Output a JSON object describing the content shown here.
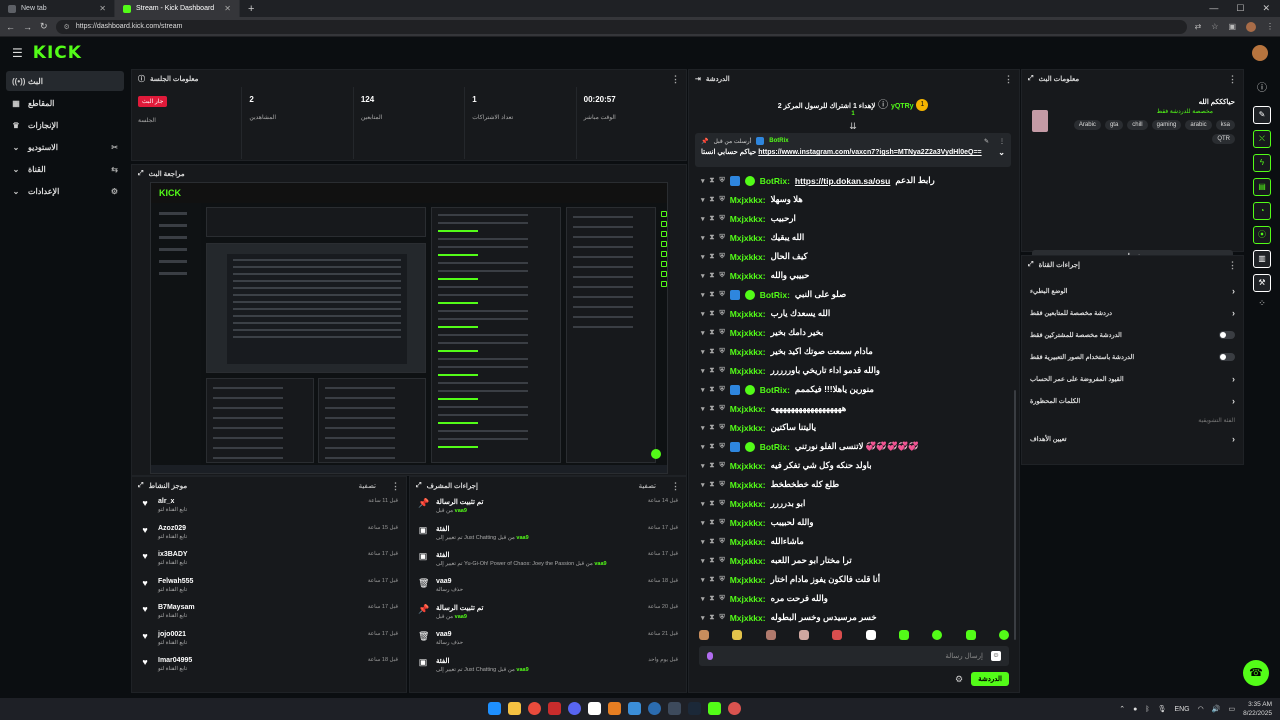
{
  "browser": {
    "tabs": [
      {
        "label": "New tab"
      },
      {
        "label": "Stream - Kick Dashboard"
      }
    ],
    "url": "https://dashboard.kick.com/stream"
  },
  "brand": {
    "logo": "KICK",
    "accent": "#53fc18"
  },
  "sidebar": {
    "items": [
      {
        "label": "البث",
        "icon": "broadcast-icon"
      },
      {
        "label": "المقاطع",
        "icon": "clips-icon"
      },
      {
        "label": "الإنجازات",
        "icon": "trophy-icon"
      },
      {
        "label": "الاستوديو",
        "icon": "studio-icon"
      },
      {
        "label": "القناة",
        "icon": "channel-icon"
      },
      {
        "label": "الإعدادات",
        "icon": "settings-icon"
      }
    ]
  },
  "session": {
    "title": "معلومات الجلسة",
    "stats": [
      {
        "value": "جار البث",
        "label": "الجلسة"
      },
      {
        "value": "2",
        "label": "المشاهدين"
      },
      {
        "value": "124",
        "label": "المتابعين"
      },
      {
        "value": "1",
        "label": "تعداد الاشتراكات"
      },
      {
        "value": "00:20:57",
        "label": "الوقت مباشر"
      }
    ]
  },
  "preview": {
    "title": "مراجعة البث"
  },
  "activity": {
    "title": "موجز النشاط",
    "filter": "تصفية",
    "rows": [
      {
        "name": "alr_x",
        "sub": "تابع القناة لتو",
        "time": "قبل 11 ساعة"
      },
      {
        "name": "Azoz029",
        "sub": "تابع القناة لتو",
        "time": "قبل 15 ساعة"
      },
      {
        "name": "ix3BADY",
        "sub": "تابع القناة لتو",
        "time": "قبل 17 ساعة"
      },
      {
        "name": "Felwah555",
        "sub": "تابع القناة لتو",
        "time": "قبل 17 ساعة"
      },
      {
        "name": "B7Maysam",
        "sub": "تابع القناة لتو",
        "time": "قبل 17 ساعة"
      },
      {
        "name": "jojo0021",
        "sub": "تابع القناة لتو",
        "time": "قبل 17 ساعة"
      },
      {
        "name": "Imar04995",
        "sub": "تابع القناة لتو",
        "time": "قبل 18 ساعة"
      }
    ]
  },
  "modactions": {
    "title": "إجراءات المشرف",
    "filter": "تصفية",
    "rows": [
      {
        "name": "تم تثبيت الرسالة",
        "sub_pre": "من قبل",
        "sub_hl": "vaa9",
        "time": "قبل 14 ساعة",
        "icon": "pin-icon"
      },
      {
        "name": "الفئة",
        "sub_pre": "تم تغيير إلى Just Chatting من قبل",
        "sub_hl": "vaa9",
        "time": "قبل 17 ساعة",
        "icon": "category-icon"
      },
      {
        "name": "الفئة",
        "sub_pre": "تم تغيير إلى Yu-Gi-Oh! Power of Chaos: Joey the Passion من قبل",
        "sub_hl": "vaa9",
        "time": "قبل 17 ساعة",
        "icon": "category-icon"
      },
      {
        "name": "vaa9",
        "sub_pre": "حذف رسالة",
        "sub_hl": "",
        "time": "قبل 18 ساعة",
        "icon": "trash-icon"
      },
      {
        "name": "تم تثبيت الرسالة",
        "sub_pre": "من قبل",
        "sub_hl": "vaa9",
        "time": "قبل 20 ساعة",
        "icon": "pin-icon"
      },
      {
        "name": "vaa9",
        "sub_pre": "حذف رسالة",
        "sub_hl": "",
        "time": "قبل 21 ساعة",
        "icon": "trash-icon"
      },
      {
        "name": "الفئة",
        "sub_pre": "تم تغيير إلى Just Chatting من قبل",
        "sub_hl": "vaa9",
        "time": "قبل يوم واحد",
        "icon": "category-icon"
      }
    ]
  },
  "chat": {
    "title": "الدردشة",
    "gifter": "yQTRy",
    "gifter_count": "1",
    "gift_text": "لإهداء 1 اشتراك للرسول المركز 2",
    "pinned_by": "أرسلت من قبل",
    "pinned_user": "BotRix",
    "pinned_text": "حياكم حسابي انستا",
    "pinned_link": "https://www.instagram.com/vaxcn7?igsh=MTNya2Z2a3VydHl0eQ==",
    "messages": [
      {
        "user": "BotRix:",
        "text": "رابط الدعم",
        "link": "https://tip.dokan.sa/osu",
        "bot": true
      },
      {
        "user": "Mxjxkkx:",
        "text": "هلا وسهلا",
        "bot": false
      },
      {
        "user": "Mxjxkkx:",
        "text": "ارحبيب",
        "bot": false
      },
      {
        "user": "Mxjxkkx:",
        "text": "الله يبقيك",
        "bot": false
      },
      {
        "user": "Mxjxkkx:",
        "text": "كيف الحال",
        "bot": false
      },
      {
        "user": "Mxjxkkx:",
        "text": "حبيبي والله",
        "bot": false
      },
      {
        "user": "BotRix:",
        "text": "صلو على النبي",
        "bot": true
      },
      {
        "user": "Mxjxkkx:",
        "text": "الله يسعدك يارب",
        "bot": false
      },
      {
        "user": "Mxjxkkx:",
        "text": "بخير دامك بخير",
        "bot": false
      },
      {
        "user": "Mxjxkkx:",
        "text": "مادام سمعت صوتك اكيد بخير",
        "bot": false
      },
      {
        "user": "Mxjxkkx:",
        "text": "والله قدمو اداء تاريخي باوررررر",
        "bot": false
      },
      {
        "user": "BotRix:",
        "text": "منورين ياهلا!!! فيكممم",
        "bot": true
      },
      {
        "user": "Mxjxkkx:",
        "text": "ههههههههههههههههههه",
        "bot": false
      },
      {
        "user": "Mxjxkkx:",
        "text": "ياليتنا ساكتين",
        "bot": false
      },
      {
        "user": "BotRix:",
        "text": "لاتنسى الفلو نورتني 💞💞💞💞💞",
        "bot": true
      },
      {
        "user": "Mxjxkkx:",
        "text": "باولد حنكه وكل شي تفكر فيه",
        "bot": false
      },
      {
        "user": "Mxjxkkx:",
        "text": "طلع كله خطخطخط",
        "bot": false
      },
      {
        "user": "Mxjxkkx:",
        "text": "ابو بدرررر",
        "bot": false
      },
      {
        "user": "Mxjxkkx:",
        "text": "والله لحبيبب",
        "bot": false
      },
      {
        "user": "Mxjxkkx:",
        "text": "ماشاءالله",
        "bot": false
      },
      {
        "user": "Mxjxkkx:",
        "text": "ترا مختار ابو حمر اللعبه",
        "bot": false
      },
      {
        "user": "Mxjxkkx:",
        "text": "أنا قلت فالكون يفوز مادام اختار",
        "bot": false
      },
      {
        "user": "Mxjxkkx:",
        "text": "والله فرحت مره",
        "bot": false
      },
      {
        "user": "Mxjxkkx:",
        "text": "خسر مرسيدس وخسر البطوله",
        "bot": false
      }
    ],
    "input_placeholder": "إرسال رسالة",
    "send_label": "الدردشة"
  },
  "stream_info": {
    "title": "معلومات البث",
    "stream_title": "حياكككم الله",
    "subtitle": "مخصصة للدردشة فقط",
    "tags": [
      "Arabic",
      "gta",
      "chill",
      "gaming",
      "arabic",
      "ksa",
      "QTR"
    ],
    "edit_label": "تعديل"
  },
  "channel_actions": {
    "title": "إجراءات القناة",
    "rows": [
      {
        "label": "الوضع البطيء",
        "type": "arrow"
      },
      {
        "label": "دردشة مخصصة للمتابعين فقط",
        "type": "arrow"
      },
      {
        "label": "الدردشة مخصصة للمشتركين فقط",
        "type": "toggle"
      },
      {
        "label": "الدردشة باستخدام الصور التعبيرية فقط",
        "type": "toggle"
      },
      {
        "label": "القيود المفروضة على عمر الحساب",
        "type": "arrow"
      },
      {
        "label": "الكلمات المحظورة",
        "type": "arrow"
      }
    ],
    "section": "الفئة التشويقية",
    "goals_label": "تعيين الأهداف"
  },
  "taskbar": {
    "lang": "ENG",
    "time": "3:35 AM",
    "date": "8/22/2025"
  }
}
